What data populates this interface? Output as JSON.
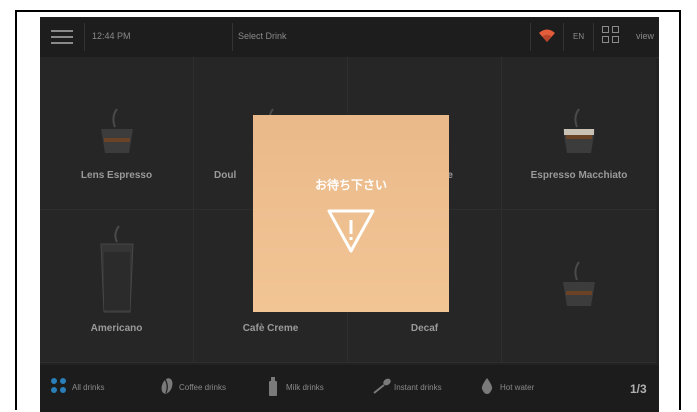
{
  "topbar": {
    "time": "12:44 PM",
    "title": "Select Drink",
    "language": "EN",
    "view_label": "view",
    "wifi_color": "#e35d3b"
  },
  "drinks": [
    {
      "label": "Lens Espresso",
      "icon": "espresso-cup-icon"
    },
    {
      "label": "Doul",
      "icon": "espresso-cup-icon"
    },
    {
      "label": "ee",
      "icon": "coffee-cup-icon"
    },
    {
      "label": "Espresso Macchiato",
      "icon": "macchiato-cup-icon"
    },
    {
      "label": "Americano",
      "icon": "tall-glass-icon"
    },
    {
      "label": "Cafè Creme",
      "icon": "coffee-cup-icon"
    },
    {
      "label": "Decaf",
      "icon": "coffee-cup-icon"
    },
    {
      "label": "",
      "icon": "espresso-cup-icon"
    }
  ],
  "modal": {
    "message": "お待ち下さい",
    "icon": "warning-triangle-icon",
    "color": "#eebf90"
  },
  "categories": [
    {
      "label": "All drinks",
      "icon": "grid-dots-icon",
      "active": true
    },
    {
      "label": "Coffee drinks",
      "icon": "coffee-bean-icon"
    },
    {
      "label": "Milk drinks",
      "icon": "milk-bottle-icon"
    },
    {
      "label": "Instant drinks",
      "icon": "spoon-icon"
    },
    {
      "label": "Hot water",
      "icon": "water-drop-icon"
    }
  ],
  "pagination": {
    "page": "1/3"
  },
  "accent_color": "#2a7fb8"
}
